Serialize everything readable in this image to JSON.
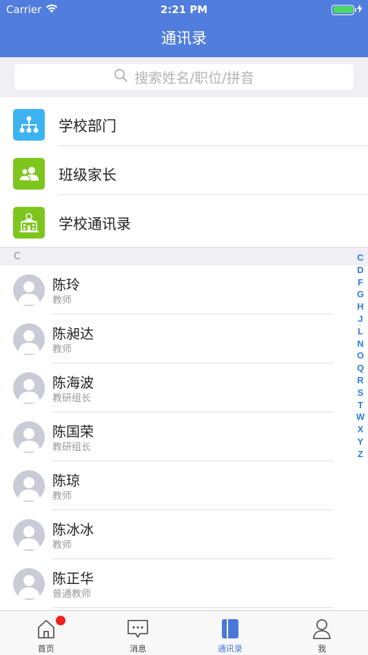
{
  "status_bar": {
    "carrier": "Carrier",
    "time": "2:21 PM"
  },
  "header": {
    "title": "通讯录"
  },
  "search": {
    "placeholder": "搜索姓名/职位/拼音"
  },
  "menu": [
    {
      "label": "学校部门",
      "icon": "org-chart-icon",
      "color": "#3db3f2"
    },
    {
      "label": "班级家长",
      "icon": "people-icon",
      "color": "#7ec61e"
    },
    {
      "label": "学校通讯录",
      "icon": "school-building-icon",
      "color": "#7ec61e"
    }
  ],
  "section": {
    "letter": "C"
  },
  "contacts": [
    {
      "name": "陈玲",
      "role": "教师"
    },
    {
      "name": "陈昶达",
      "role": "教师"
    },
    {
      "name": "陈海波",
      "role": "教研组长"
    },
    {
      "name": "陈国荣",
      "role": "教研组长"
    },
    {
      "name": "陈琼",
      "role": "教师"
    },
    {
      "name": "陈冰冰",
      "role": "教师"
    },
    {
      "name": "陈正华",
      "role": "普通教师"
    }
  ],
  "index_letters": [
    "C",
    "D",
    "F",
    "G",
    "H",
    "J",
    "L",
    "N",
    "O",
    "Q",
    "R",
    "S",
    "T",
    "W",
    "X",
    "Y",
    "Z"
  ],
  "tabbar": {
    "tabs": [
      {
        "label": "首页",
        "icon": "home-icon",
        "badge": true
      },
      {
        "label": "消息",
        "icon": "message-icon",
        "badge": false
      },
      {
        "label": "通讯录",
        "icon": "contacts-book-icon",
        "active": true
      },
      {
        "label": "我",
        "icon": "person-icon",
        "badge": false
      }
    ]
  },
  "colors": {
    "header": "#507dde",
    "accent": "#2f7be5",
    "badge": "#f0201e"
  }
}
